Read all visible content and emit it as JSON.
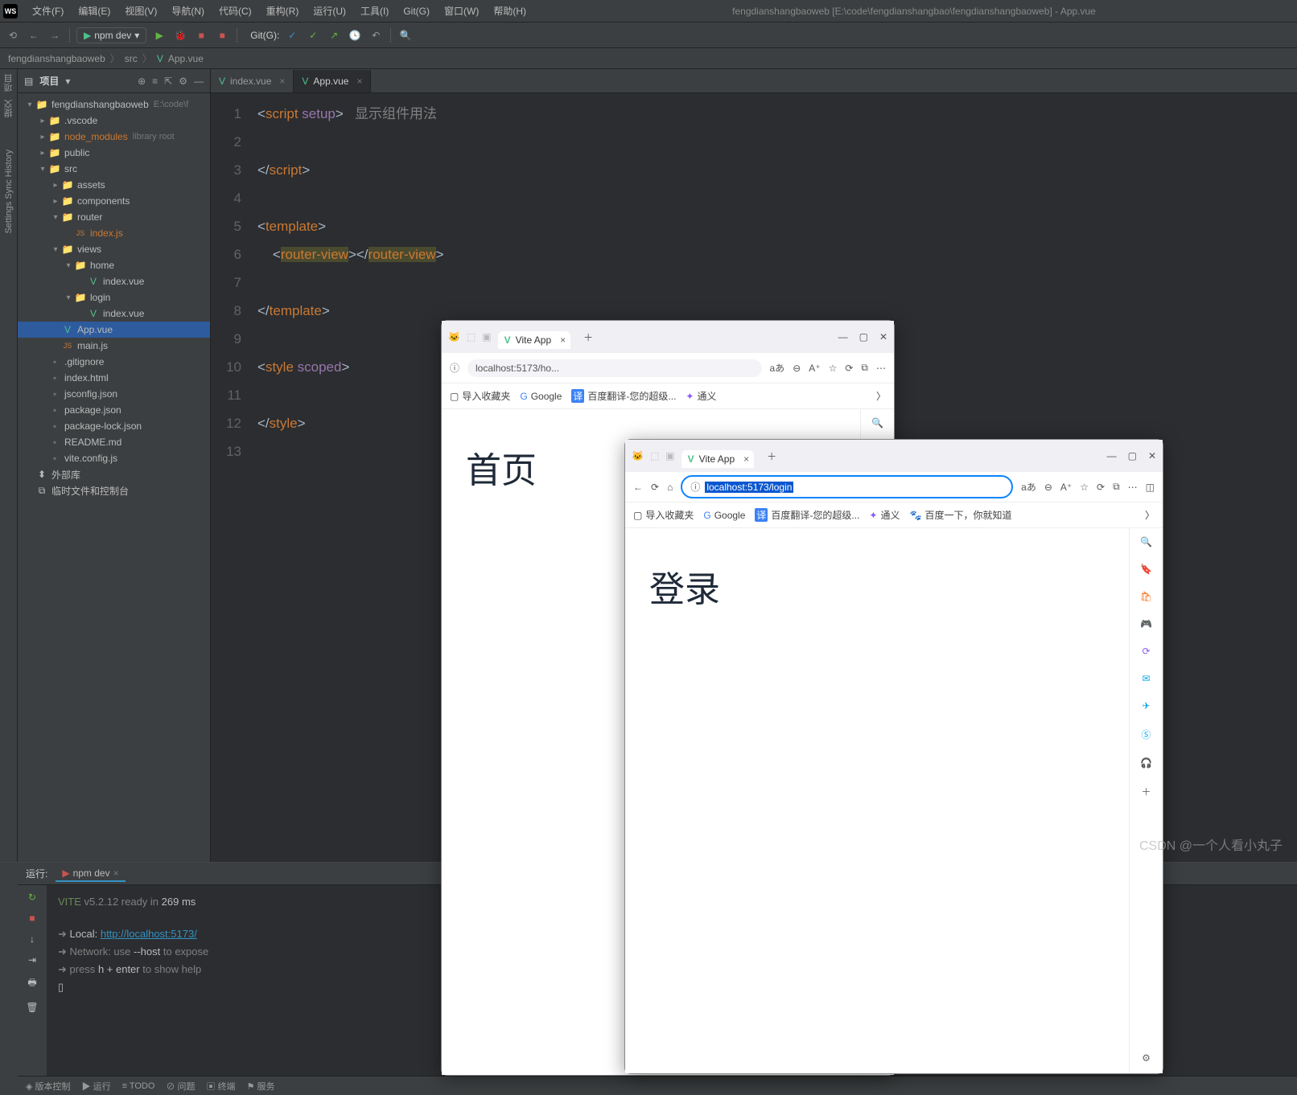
{
  "menu": {
    "logo": "WS",
    "file": "文件(F)",
    "edit": "编辑(E)",
    "view": "视图(V)",
    "nav": "导航(N)",
    "code": "代码(C)",
    "refactor": "重构(R)",
    "run": "运行(U)",
    "tools": "工具(I)",
    "git": "Git(G)",
    "window": "窗口(W)",
    "help": "帮助(H)"
  },
  "title": "fengdianshangbaoweb [E:\\code\\fengdianshangbao\\fengdianshangbaoweb] - App.vue",
  "toolbar": {
    "run_cfg": "npm dev",
    "git": "Git(G):"
  },
  "breadcrumb": {
    "a": "fengdianshangbaoweb",
    "b": "src",
    "c": "App.vue"
  },
  "proj": {
    "header": "项目",
    "tool": "⚙",
    "collapse": "—",
    "tree": [
      {
        "d": 0,
        "arrow": "▾",
        "ico": "📁",
        "name": "fengdianshangbaoweb",
        "hint": "E:\\code\\f"
      },
      {
        "d": 1,
        "arrow": "▸",
        "ico": "📁",
        "name": ".vscode"
      },
      {
        "d": 1,
        "arrow": "▸",
        "ico": "📁",
        "name": "node_modules",
        "hint": "library root",
        "cls": "orange"
      },
      {
        "d": 1,
        "arrow": "▸",
        "ico": "📁",
        "name": "public"
      },
      {
        "d": 1,
        "arrow": "▾",
        "ico": "📁",
        "name": "src"
      },
      {
        "d": 2,
        "arrow": "▸",
        "ico": "📁",
        "name": "assets"
      },
      {
        "d": 2,
        "arrow": "▸",
        "ico": "📁",
        "name": "components"
      },
      {
        "d": 2,
        "arrow": "▾",
        "ico": "📁",
        "name": "router"
      },
      {
        "d": 3,
        "arrow": "",
        "ico": "JS",
        "name": "index.js",
        "cls": "orange"
      },
      {
        "d": 2,
        "arrow": "▾",
        "ico": "📁",
        "name": "views"
      },
      {
        "d": 3,
        "arrow": "▾",
        "ico": "📁",
        "name": "home"
      },
      {
        "d": 4,
        "arrow": "",
        "ico": "V",
        "name": "index.vue"
      },
      {
        "d": 3,
        "arrow": "▾",
        "ico": "📁",
        "name": "login"
      },
      {
        "d": 4,
        "arrow": "",
        "ico": "V",
        "name": "index.vue"
      },
      {
        "d": 2,
        "arrow": "",
        "ico": "V",
        "name": "App.vue",
        "sel": true
      },
      {
        "d": 2,
        "arrow": "",
        "ico": "JS",
        "name": "main.js"
      },
      {
        "d": 1,
        "arrow": "",
        "ico": "◦",
        ".": true,
        "name": ".gitignore"
      },
      {
        "d": 1,
        "arrow": "",
        "ico": "◦",
        "name": "index.html"
      },
      {
        "d": 1,
        "arrow": "",
        "ico": "◦",
        "name": "jsconfig.json"
      },
      {
        "d": 1,
        "arrow": "",
        "ico": "◦",
        "name": "package.json"
      },
      {
        "d": 1,
        "arrow": "",
        "ico": "◦",
        "name": "package-lock.json"
      },
      {
        "d": 1,
        "arrow": "",
        "ico": "◦",
        "name": "README.md"
      },
      {
        "d": 1,
        "arrow": "",
        "ico": "◦",
        "name": "vite.config.js"
      },
      {
        "d": 0,
        "arrow": "",
        "ico": "⬍",
        "name": "外部库"
      },
      {
        "d": 0,
        "arrow": "",
        "ico": "⧉",
        "name": "临时文件和控制台"
      }
    ]
  },
  "tabs": [
    {
      "name": "index.vue",
      "active": false
    },
    {
      "name": "App.vue",
      "active": true
    }
  ],
  "code_lines": [
    "1",
    "2",
    "3",
    "4",
    "5",
    "6",
    "7",
    "8",
    "9",
    "10",
    "11",
    "12",
    "13"
  ],
  "code": {
    "hint": "显示组件用法"
  },
  "run": {
    "label": "运行:",
    "tab": "npm dev",
    "l1a": "VITE",
    "l1b": "v5.2.12  ready in",
    "l1c": "269 ms",
    "l2a": "Local:",
    "l2b": "http://localhost:5173/",
    "l3a": "Network: use",
    "l3b": "--host",
    "l3c": "to expose",
    "l4a": "press",
    "l4b": "h + enter",
    "l4c": "to show help"
  },
  "status": {
    "vcs": "版本控制",
    "run": "运行",
    "todo": "TODO",
    "problems": "问题",
    "terminal": "终端",
    "services": "服务"
  },
  "browser1": {
    "tab": "Vite App",
    "url": "localhost:5173/ho...",
    "bk1": "导入收藏夹",
    "bk2": "Google",
    "bk3": "百度翻译-您的超级...",
    "bk4": "通义",
    "page": "首页"
  },
  "browser2": {
    "tab": "Vite App",
    "url": "localhost:5173/login",
    "bk1": "导入收藏夹",
    "bk2": "Google",
    "bk3": "百度翻译-您的超级...",
    "bk4": "通义",
    "bk5": "百度一下，你就知道",
    "page": "登录"
  },
  "watermark": "CSDN @一个人看小丸子",
  "left_labels": {
    "proj": "项目",
    "commit": "提交",
    "sync": "Settings Sync History"
  }
}
